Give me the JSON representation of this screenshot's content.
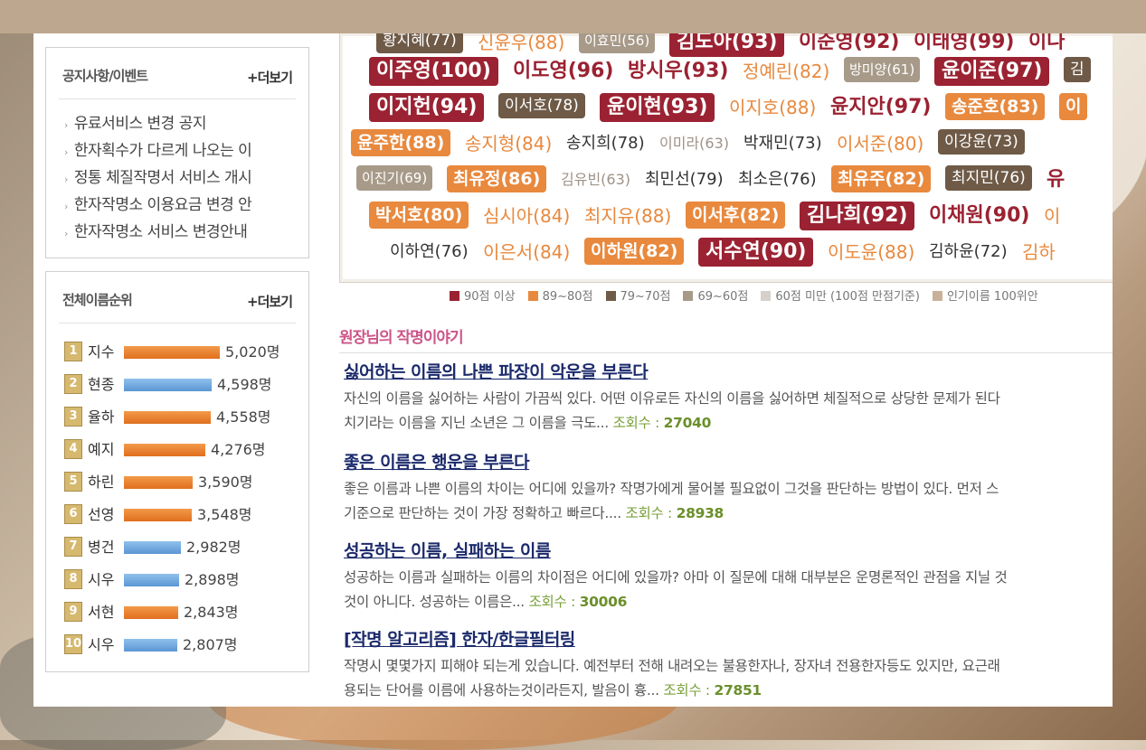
{
  "notice": {
    "title": "공지사항/이벤트",
    "more": "+더보기",
    "items": [
      "유료서비스 변경 공지",
      "한자획수가 다르게 나오는 이",
      "정통 체질작명서 서비스 개시",
      "한자작명소 이용요금 변경 안",
      "한자작명소 서비스 변경안내"
    ]
  },
  "ranking": {
    "title": "전체이름순위",
    "more": "+더보기",
    "items": [
      {
        "rank": "1",
        "name": "지수",
        "count": "5,020명",
        "value": 5020,
        "gender": "f"
      },
      {
        "rank": "2",
        "name": "현종",
        "count": "4,598명",
        "value": 4598,
        "gender": "m"
      },
      {
        "rank": "3",
        "name": "율하",
        "count": "4,558명",
        "value": 4558,
        "gender": "f"
      },
      {
        "rank": "4",
        "name": "예지",
        "count": "4,276명",
        "value": 4276,
        "gender": "f"
      },
      {
        "rank": "5",
        "name": "하린",
        "count": "3,590명",
        "value": 3590,
        "gender": "f"
      },
      {
        "rank": "6",
        "name": "선영",
        "count": "3,548명",
        "value": 3548,
        "gender": "f"
      },
      {
        "rank": "7",
        "name": "병건",
        "count": "2,982명",
        "value": 2982,
        "gender": "m"
      },
      {
        "rank": "8",
        "name": "시우",
        "count": "2,898명",
        "value": 2898,
        "gender": "m"
      },
      {
        "rank": "9",
        "name": "서현",
        "count": "2,843명",
        "value": 2843,
        "gender": "f"
      },
      {
        "rank": "10",
        "name": "시우",
        "count": "2,807명",
        "value": 2807,
        "gender": "m"
      }
    ]
  },
  "cloud": {
    "rows": [
      [
        [
          "황지혜(77)",
          "t3"
        ],
        [
          "신윤우(88)",
          "t2t"
        ],
        [
          "이효민(56)",
          "t4"
        ],
        [
          "김도아(93)",
          "t1"
        ],
        [
          "이준영(92)",
          "t1t"
        ],
        [
          "이태영(99)",
          "t1t"
        ],
        [
          "이나",
          "t1t"
        ]
      ],
      [
        [
          "이주영(100)",
          "t1"
        ],
        [
          "이도영(96)",
          "t1t"
        ],
        [
          "방시우(93)",
          "t1t"
        ],
        [
          "정예린(82)",
          "t2t"
        ],
        [
          "방미양(61)",
          "t4"
        ],
        [
          "윤이준(97)",
          "t1"
        ],
        [
          "김",
          "t3"
        ]
      ],
      [
        [
          "이지헌(94)",
          "t1"
        ],
        [
          "이서호(78)",
          "t3"
        ],
        [
          "윤이현(93)",
          "t1"
        ],
        [
          "이지호(88)",
          "t2t"
        ],
        [
          "윤지안(97)",
          "t1t"
        ],
        [
          "송준호(83)",
          "t2"
        ],
        [
          "이",
          "t2"
        ]
      ],
      [
        [
          "윤주한(88)",
          "t2"
        ],
        [
          "송지형(84)",
          "t2t"
        ],
        [
          "송지희(78)",
          "t3t"
        ],
        [
          "이미라(63)",
          "t4t"
        ],
        [
          "박재민(73)",
          "t3t"
        ],
        [
          "이서준(80)",
          "t2t"
        ],
        [
          "이강윤(73)",
          "t3"
        ]
      ],
      [
        [
          "이진기(69)",
          "t4"
        ],
        [
          "최유정(86)",
          "t2"
        ],
        [
          "김유빈(63)",
          "t4t"
        ],
        [
          "최민선(79)",
          "t3t"
        ],
        [
          "최소은(76)",
          "t3t"
        ],
        [
          "최유주(82)",
          "t2"
        ],
        [
          "최지민(76)",
          "t3"
        ],
        [
          "유",
          "t1t"
        ]
      ],
      [
        [
          "박서호(80)",
          "t2"
        ],
        [
          "심시아(84)",
          "t2t"
        ],
        [
          "최지유(88)",
          "t2t"
        ],
        [
          "이서후(82)",
          "t2"
        ],
        [
          "김나희(92)",
          "t1"
        ],
        [
          "이채원(90)",
          "t1t"
        ],
        [
          "이",
          "t2t"
        ]
      ],
      [
        [
          "이하연(76)",
          "t3t"
        ],
        [
          "이은서(84)",
          "t2t"
        ],
        [
          "이하원(82)",
          "t2"
        ],
        [
          "서수연(90)",
          "t1"
        ],
        [
          "이도윤(88)",
          "t2t"
        ],
        [
          "김하윤(72)",
          "t3t"
        ],
        [
          "김하",
          "t2t"
        ]
      ]
    ]
  },
  "legend": [
    {
      "label": "90점 이상",
      "color": "#9b2232"
    },
    {
      "label": "89~80점",
      "color": "#e8893e"
    },
    {
      "label": "79~70점",
      "color": "#6e5a47"
    },
    {
      "label": "69~60점",
      "color": "#a89a89"
    },
    {
      "label": "60점 미만 (100점 만점기준)",
      "color": "#d5d0ca"
    },
    {
      "label": "인기이름 100위안",
      "color": "#c7b299"
    }
  ],
  "stories": {
    "title": "원장님의 작명이야기",
    "items": [
      {
        "headline": "싫어하는 이름의 나쁜 파장이 악운을 부른다",
        "line1": "자신의 이름을 싫어하는 사람이 가끔씩 있다. 어떤 이유로든 자신의 이름을 싫어하면 체질적으로 상당한 문제가 된다",
        "line2": "치기라는 이름을 지닌 소년은 그 이름을 극도...",
        "views_label": "조회수 :",
        "views": "27040"
      },
      {
        "headline": "좋은 이름은 행운을 부른다",
        "line1": "좋은 이름과 나쁜 이름의 차이는 어디에 있을까? 작명가에게 물어볼 필요없이 그것을 판단하는 방법이 있다. 먼저 스",
        "line2": "기준으로 판단하는 것이 가장 정확하고 빠르다....",
        "views_label": "조회수 :",
        "views": "28938"
      },
      {
        "headline": "성공하는 이름, 실패하는 이름",
        "line1": "성공하는 이름과 실패하는 이름의 차이점은 어디에 있을까? 아마 이 질문에 대해 대부분은 운명론적인 관점을 지닐 것",
        "line2": "것이 아니다. 성공하는 이름은...",
        "views_label": "조회수 :",
        "views": "30006"
      },
      {
        "headline": "[작명 알고리즘] 한자/한글필터링",
        "line1": "작명시 몇몇가지 피해야 되는게 있습니다. 예전부터 전해 내려오는 불용한자나, 장자녀 전용한자등도 있지만, 요근래",
        "line2": "용되는 단어를 이름에 사용하는것이라든지, 발음이 흉...",
        "views_label": "조회수 :",
        "views": "27851"
      }
    ]
  }
}
